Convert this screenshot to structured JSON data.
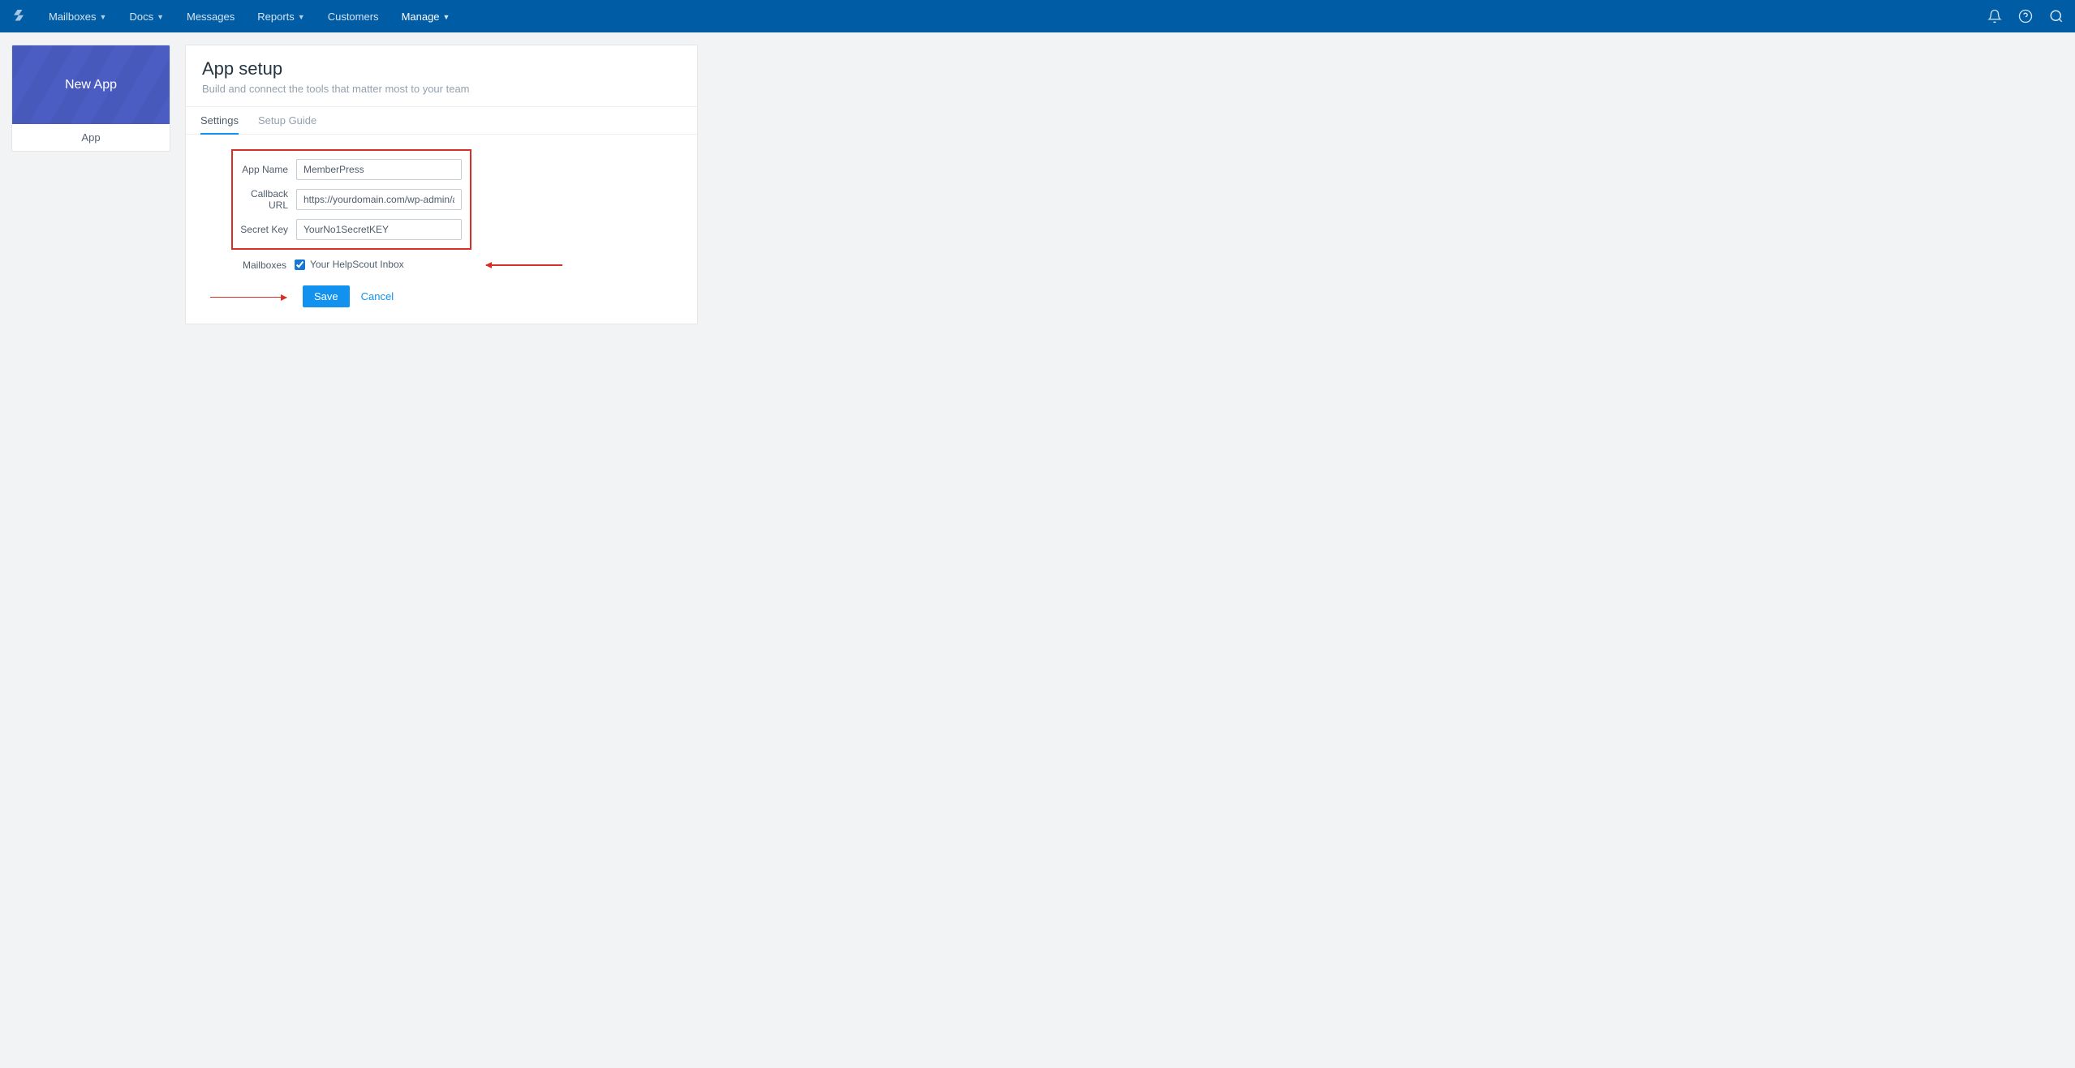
{
  "nav": {
    "items": [
      {
        "label": "Mailboxes",
        "dropdown": true,
        "active": false
      },
      {
        "label": "Docs",
        "dropdown": true,
        "active": false
      },
      {
        "label": "Messages",
        "dropdown": false,
        "active": false
      },
      {
        "label": "Reports",
        "dropdown": true,
        "active": false
      },
      {
        "label": "Customers",
        "dropdown": false,
        "active": false
      },
      {
        "label": "Manage",
        "dropdown": true,
        "active": true
      }
    ]
  },
  "sidebar": {
    "title": "New App",
    "link": "App"
  },
  "panel": {
    "title": "App setup",
    "subtitle": "Build and connect the tools that matter most to your team"
  },
  "tabs": [
    {
      "label": "Settings",
      "active": true
    },
    {
      "label": "Setup Guide",
      "active": false
    }
  ],
  "form": {
    "app_name": {
      "label": "App Name",
      "value": "MemberPress"
    },
    "callback_url": {
      "label": "Callback URL",
      "value": "https://yourdomain.com/wp-admin/admin-a"
    },
    "secret_key": {
      "label": "Secret Key",
      "value": "YourNo1SecretKEY"
    },
    "mailboxes": {
      "label": "Mailboxes",
      "option": "Your HelpScout Inbox",
      "checked": true
    }
  },
  "buttons": {
    "save": "Save",
    "cancel": "Cancel"
  }
}
